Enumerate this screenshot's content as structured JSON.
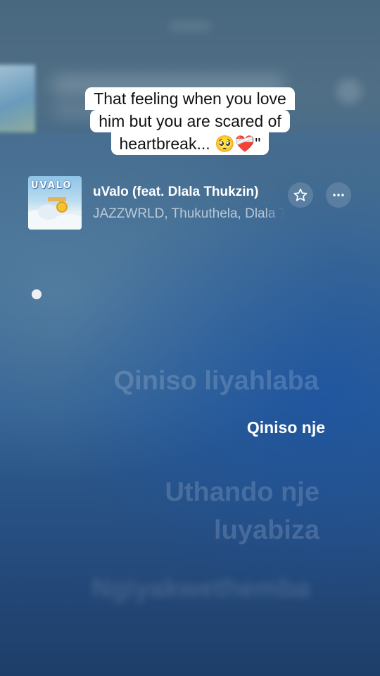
{
  "caption": {
    "lines": [
      "That feeling when you love",
      "him but you are scared of",
      "heartbreak... 🥺❤️‍🩹\""
    ]
  },
  "now_playing": {
    "artwork_text": "UVALO",
    "title": "uValo (feat. Dlala Thukzin)",
    "artists": "JAZZWRLD, Thukuthela, Dlala Thukzin",
    "favorite_icon": "star-outline-icon",
    "more_icon": "ellipsis-icon"
  },
  "lyrics": {
    "previous": "Qiniso liyahlaba",
    "current": "Qiniso nje",
    "next_line1": "Uthando nje",
    "next_line2": "luyabiza",
    "upcoming": "Ngiyakwethemba"
  },
  "colors": {
    "background_top": "#4f6f8a",
    "background_bottom": "#1d3e68",
    "caption_bg": "#ffffff",
    "caption_text": "#111111"
  }
}
